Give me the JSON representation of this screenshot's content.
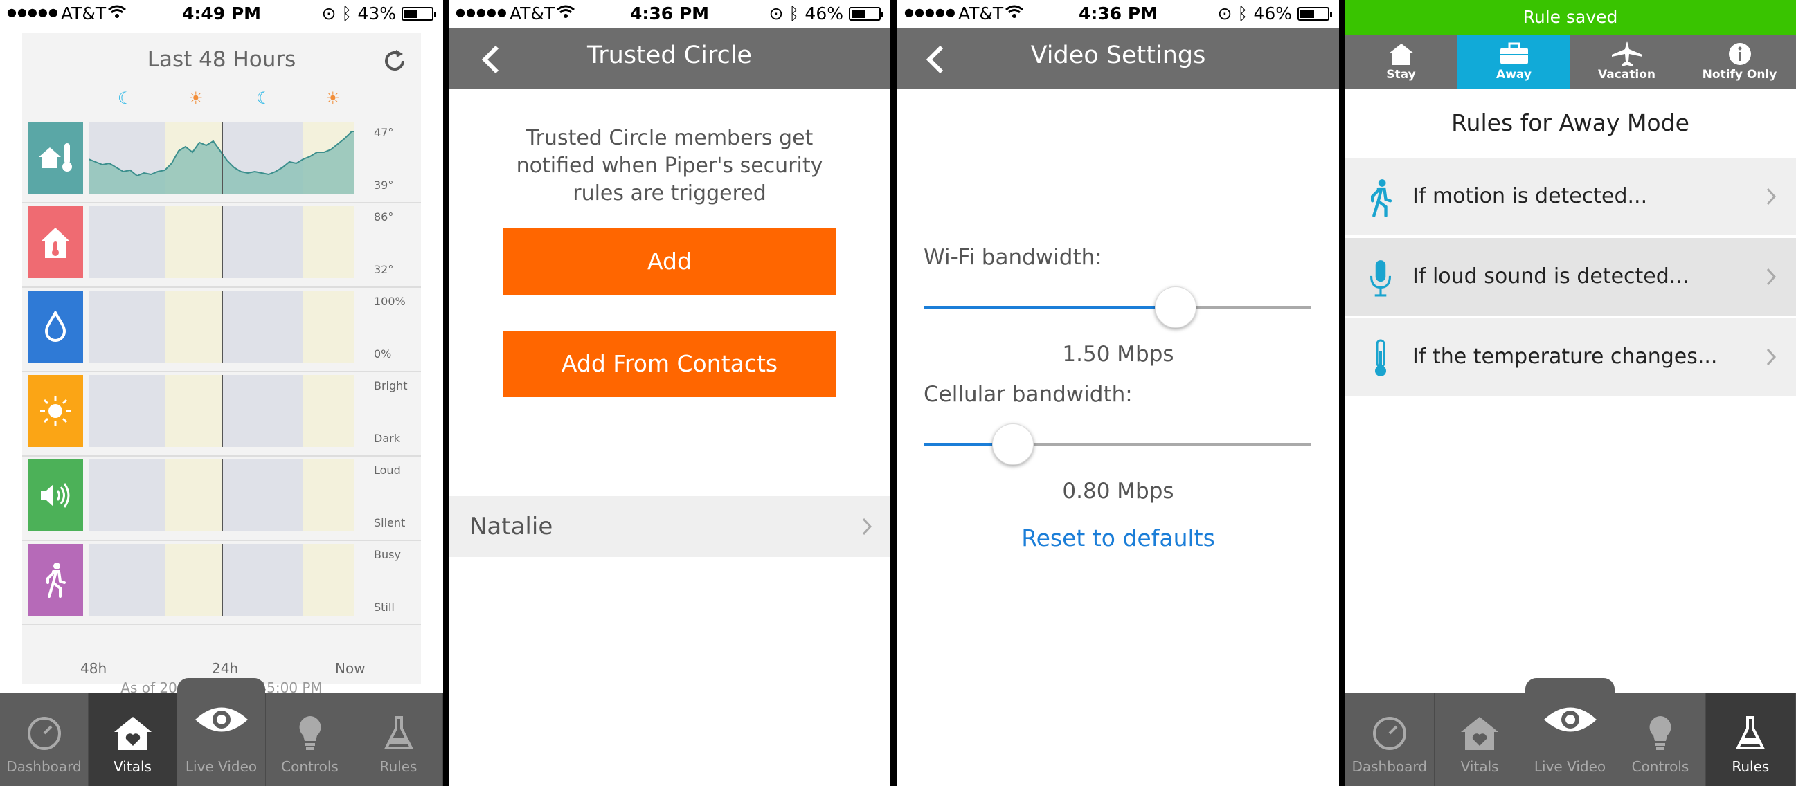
{
  "screens": {
    "vitals": {
      "status": {
        "carrier": "AT&T",
        "time": "4:49 PM",
        "battery": "43%"
      },
      "title": "Last 48 Hours",
      "rows": [
        {
          "name": "temperature-home",
          "max": "47°",
          "min": "39°",
          "color": "#5aa7a6"
        },
        {
          "name": "temperature-alert",
          "max": "86°",
          "min": "32°",
          "color": "#ef6b72"
        },
        {
          "name": "humidity",
          "max": "100%",
          "min": "0%",
          "color": "#2f7ad6"
        },
        {
          "name": "light",
          "max": "Bright",
          "min": "Dark",
          "color": "#fba515"
        },
        {
          "name": "sound",
          "max": "Loud",
          "min": "Silent",
          "color": "#4cb158"
        },
        {
          "name": "motion",
          "max": "Busy",
          "min": "Still",
          "color": "#b66ab8"
        }
      ],
      "xlabels": [
        "48h",
        "24h",
        "Now"
      ],
      "as_of": "As of 2014-02-18 4:45:00 PM"
    },
    "trusted": {
      "status": {
        "carrier": "AT&T",
        "time": "4:36 PM",
        "battery": "46%"
      },
      "title": "Trusted Circle",
      "description": "Trusted Circle members get notified when Piper's security rules are triggered",
      "add_label": "Add",
      "add_contacts_label": "Add From Contacts",
      "contact": "Natalie"
    },
    "video": {
      "status": {
        "carrier": "AT&T",
        "time": "4:36 PM",
        "battery": "46%"
      },
      "title": "Video Settings",
      "wifi_label": "Wi-Fi bandwidth:",
      "wifi_value": "1.50 Mbps",
      "wifi_level": 0.65,
      "cell_label": "Cellular bandwidth:",
      "cell_value": "0.80 Mbps",
      "cell_level": 0.23,
      "reset_label": "Reset to defaults"
    },
    "rules": {
      "banner": "Rule saved",
      "modes": [
        "Stay",
        "Away",
        "Vacation",
        "Notify Only"
      ],
      "title": "Rules for Away Mode",
      "items": [
        "If motion is detected...",
        "If loud sound is detected...",
        "If the temperature changes..."
      ]
    }
  },
  "tabs": [
    "Dashboard",
    "Vitals",
    "Live Video",
    "Controls",
    "Rules"
  ],
  "accent": "#ff6600",
  "link_color": "#1b7ed8"
}
